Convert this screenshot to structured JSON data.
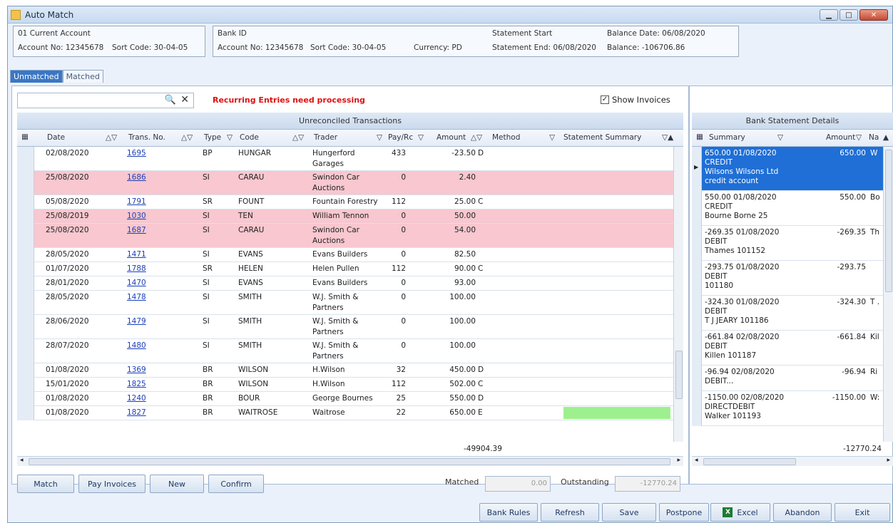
{
  "window": {
    "title": "Auto Match"
  },
  "account": {
    "name": "01 Current Account",
    "account_no": "Account No: 12345678",
    "sort_code": "Sort Code: 30-04-05"
  },
  "bank": {
    "bank_id": "Bank ID",
    "account_no": "Account No: 12345678",
    "sort_code": "Sort Code: 30-04-05",
    "currency": "Currency: PD",
    "statement_start": "Statement Start",
    "statement_end": "Statement End: 06/08/2020",
    "balance_date": "Balance Date: 06/08/2020",
    "balance": "Balance: -106706.86"
  },
  "tabs": [
    "Unmatched",
    "Matched"
  ],
  "toolbar": {
    "warning": "Recurring Entries need processing",
    "show_invoices": "Show Invoices"
  },
  "left_grid": {
    "title": "Unreconciled Transactions",
    "headers": [
      "Date",
      "Trans. No.",
      "Type",
      "Code",
      "Trader",
      "Pay/Rc",
      "Amount",
      "Method",
      "Statement Summary"
    ],
    "rows": [
      {
        "date": "02/08/2020",
        "trans": "1695",
        "type": "BP",
        "code": "HUNGAR",
        "trader": "Hungerford",
        "trader2": "Garages",
        "payrc": "433",
        "amount": "-23.50",
        "method": "D",
        "pink": false
      },
      {
        "date": "25/08/2020",
        "trans": "1686",
        "type": "SI",
        "code": "CARAU",
        "trader": "Swindon Car",
        "trader2": "Auctions",
        "payrc": "0",
        "amount": "2.40",
        "method": "",
        "pink": true
      },
      {
        "date": "05/08/2020",
        "trans": "1791",
        "type": "SR",
        "code": "FOUNT",
        "trader": "Fountain Forestry",
        "trader2": "",
        "payrc": "112",
        "amount": "25.00",
        "method": "C",
        "pink": false
      },
      {
        "date": "25/08/2019",
        "trans": "1030",
        "type": "SI",
        "code": "TEN",
        "trader": "William Tennon",
        "trader2": "",
        "payrc": "0",
        "amount": "50.00",
        "method": "",
        "pink": true
      },
      {
        "date": "25/08/2020",
        "trans": "1687",
        "type": "SI",
        "code": "CARAU",
        "trader": "Swindon Car",
        "trader2": "Auctions",
        "payrc": "0",
        "amount": "54.00",
        "method": "",
        "pink": true
      },
      {
        "date": "28/05/2020",
        "trans": "1471",
        "type": "SI",
        "code": "EVANS",
        "trader": "Evans Builders",
        "trader2": "",
        "payrc": "0",
        "amount": "82.50",
        "method": "",
        "pink": false
      },
      {
        "date": "01/07/2020",
        "trans": "1788",
        "type": "SR",
        "code": "HELEN",
        "trader": "Helen Pullen",
        "trader2": "",
        "payrc": "112",
        "amount": "90.00",
        "method": "C",
        "pink": false
      },
      {
        "date": "28/01/2020",
        "trans": "1470",
        "type": "SI",
        "code": "EVANS",
        "trader": "Evans Builders",
        "trader2": "",
        "payrc": "0",
        "amount": "93.00",
        "method": "",
        "pink": false
      },
      {
        "date": "28/05/2020",
        "trans": "1478",
        "type": "SI",
        "code": "SMITH",
        "trader": "W.J. Smith &",
        "trader2": "Partners",
        "payrc": "0",
        "amount": "100.00",
        "method": "",
        "pink": false
      },
      {
        "date": "28/06/2020",
        "trans": "1479",
        "type": "SI",
        "code": "SMITH",
        "trader": "W.J. Smith &",
        "trader2": "Partners",
        "payrc": "0",
        "amount": "100.00",
        "method": "",
        "pink": false
      },
      {
        "date": "28/07/2020",
        "trans": "1480",
        "type": "SI",
        "code": "SMITH",
        "trader": "W.J. Smith &",
        "trader2": "Partners",
        "payrc": "0",
        "amount": "100.00",
        "method": "",
        "pink": false
      },
      {
        "date": "01/08/2020",
        "trans": "1369",
        "type": "BR",
        "code": "WILSON",
        "trader": "H.Wilson",
        "trader2": "",
        "payrc": "32",
        "amount": "450.00",
        "method": "D",
        "pink": false
      },
      {
        "date": "15/01/2020",
        "trans": "1825",
        "type": "BR",
        "code": "WILSON",
        "trader": "H.Wilson",
        "trader2": "",
        "payrc": "112",
        "amount": "502.00",
        "method": "C",
        "pink": false
      },
      {
        "date": "01/08/2020",
        "trans": "1240",
        "type": "BR",
        "code": "BOUR",
        "trader": "George Bournes",
        "trader2": "",
        "payrc": "25",
        "amount": "550.00",
        "method": "D",
        "pink": false
      },
      {
        "date": "01/08/2020",
        "trans": "1827",
        "type": "BR",
        "code": "WAITROSE",
        "trader": "Waitrose",
        "trader2": "",
        "payrc": "22",
        "amount": "650.00",
        "method": "E",
        "pink": false
      }
    ],
    "total": "-49904.39"
  },
  "right_grid": {
    "title": "Bank Statement Details",
    "headers": [
      "Summary",
      "Amount",
      "Na"
    ],
    "rows": [
      {
        "lines": [
          "650.00 01/08/2020",
          "CREDIT",
          "Wilsons Wilsons Ltd",
          "credit account"
        ],
        "amount": "650.00",
        "na": "W",
        "selected": true
      },
      {
        "lines": [
          "550.00 01/08/2020",
          "CREDIT",
          "Bourne Borne 25"
        ],
        "amount": "550.00",
        "na": "Bo",
        "selected": false
      },
      {
        "lines": [
          "-269.35 01/08/2020",
          "DEBIT",
          "Thames 101152"
        ],
        "amount": "-269.35",
        "na": "Th",
        "selected": false
      },
      {
        "lines": [
          "-293.75 01/08/2020",
          "DEBIT",
          " 101180"
        ],
        "amount": "-293.75",
        "na": "",
        "selected": false
      },
      {
        "lines": [
          "-324.30 01/08/2020",
          "DEBIT",
          "T J JEARY 101186"
        ],
        "amount": "-324.30",
        "na": "T .",
        "selected": false
      },
      {
        "lines": [
          "-661.84 02/08/2020",
          "DEBIT",
          "Killen 101187"
        ],
        "amount": "-661.84",
        "na": "Kil",
        "selected": false
      },
      {
        "lines": [
          "-96.94 02/08/2020",
          "DEBIT..."
        ],
        "amount": "-96.94",
        "na": "Ri",
        "selected": false
      },
      {
        "lines": [
          "-1150.00 02/08/2020",
          "DIRECTDEBIT",
          "Walker 101193"
        ],
        "amount": "-1150.00",
        "na": "W:",
        "selected": false
      }
    ],
    "total": "-12770.24"
  },
  "actions": {
    "match": "Match",
    "pay_invoices": "Pay Invoices",
    "new": "New",
    "confirm": "Confirm",
    "matched_label": "Matched",
    "matched_value": "0.00",
    "outstanding_label": "Outstanding",
    "outstanding_value": "-12770.24"
  },
  "footer": [
    "Bank Rules",
    "Refresh",
    "Save",
    "Postpone",
    "Excel",
    "Abandon",
    "Exit"
  ]
}
